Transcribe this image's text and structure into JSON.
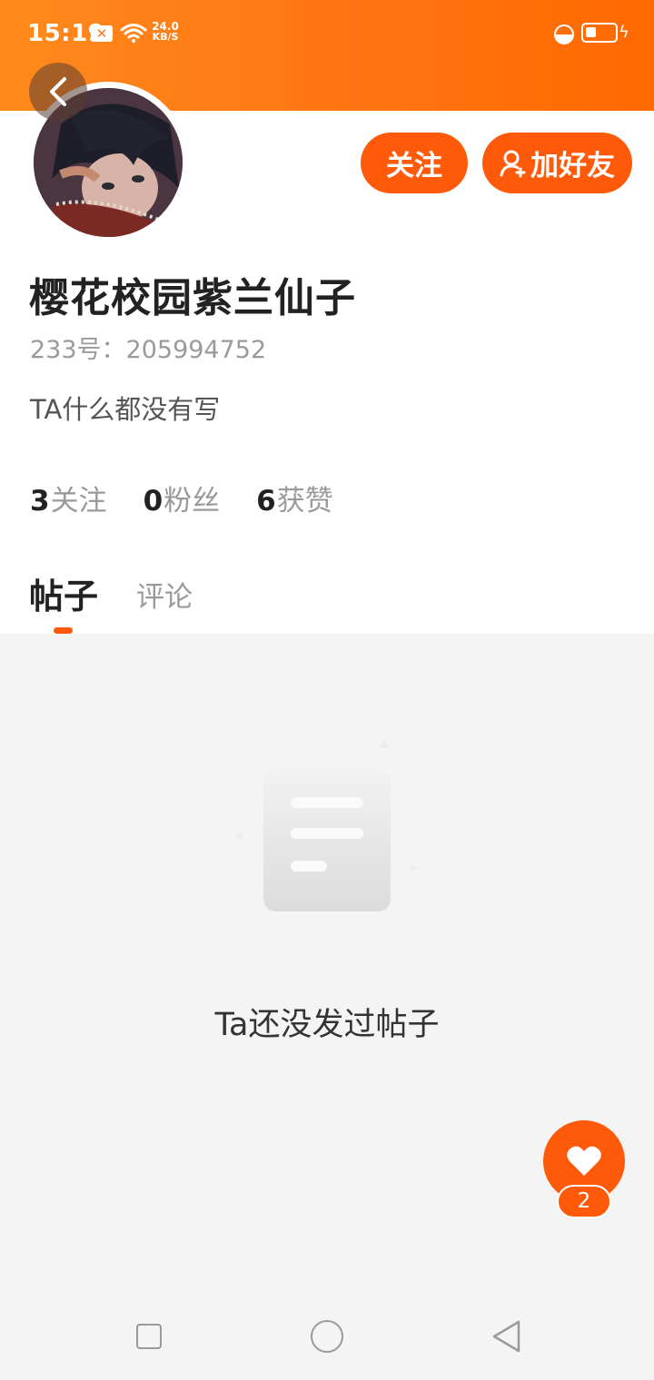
{
  "status_bar": {
    "time": "15:19",
    "notification_icon": "close-box-icon",
    "network_speed_value": "24.0",
    "network_speed_unit": "KB/S",
    "battery_level": 0.35
  },
  "profile": {
    "username": "樱花校园紫兰仙子",
    "user_id": "233号：205994752",
    "bio": "TA什么都没有写",
    "follow_label": "关注",
    "add_friend_label": "加好友",
    "stats": [
      {
        "value": "3",
        "label": "关注"
      },
      {
        "value": "0",
        "label": "粉丝"
      },
      {
        "value": "6",
        "label": "获赞"
      }
    ]
  },
  "tabs": [
    {
      "label": "帖子",
      "active": true
    },
    {
      "label": "评论",
      "active": false
    }
  ],
  "empty_state": {
    "message": "Ta还没发过帖子",
    "icon": "document-icon"
  },
  "like_fab": {
    "icon": "heart-icon",
    "count": "2"
  },
  "colors": {
    "accent": "#ff5a0a",
    "header_gradient_start": "#ff8a1c",
    "header_gradient_end": "#ff6a00",
    "muted_text": "#9a9a9a"
  }
}
